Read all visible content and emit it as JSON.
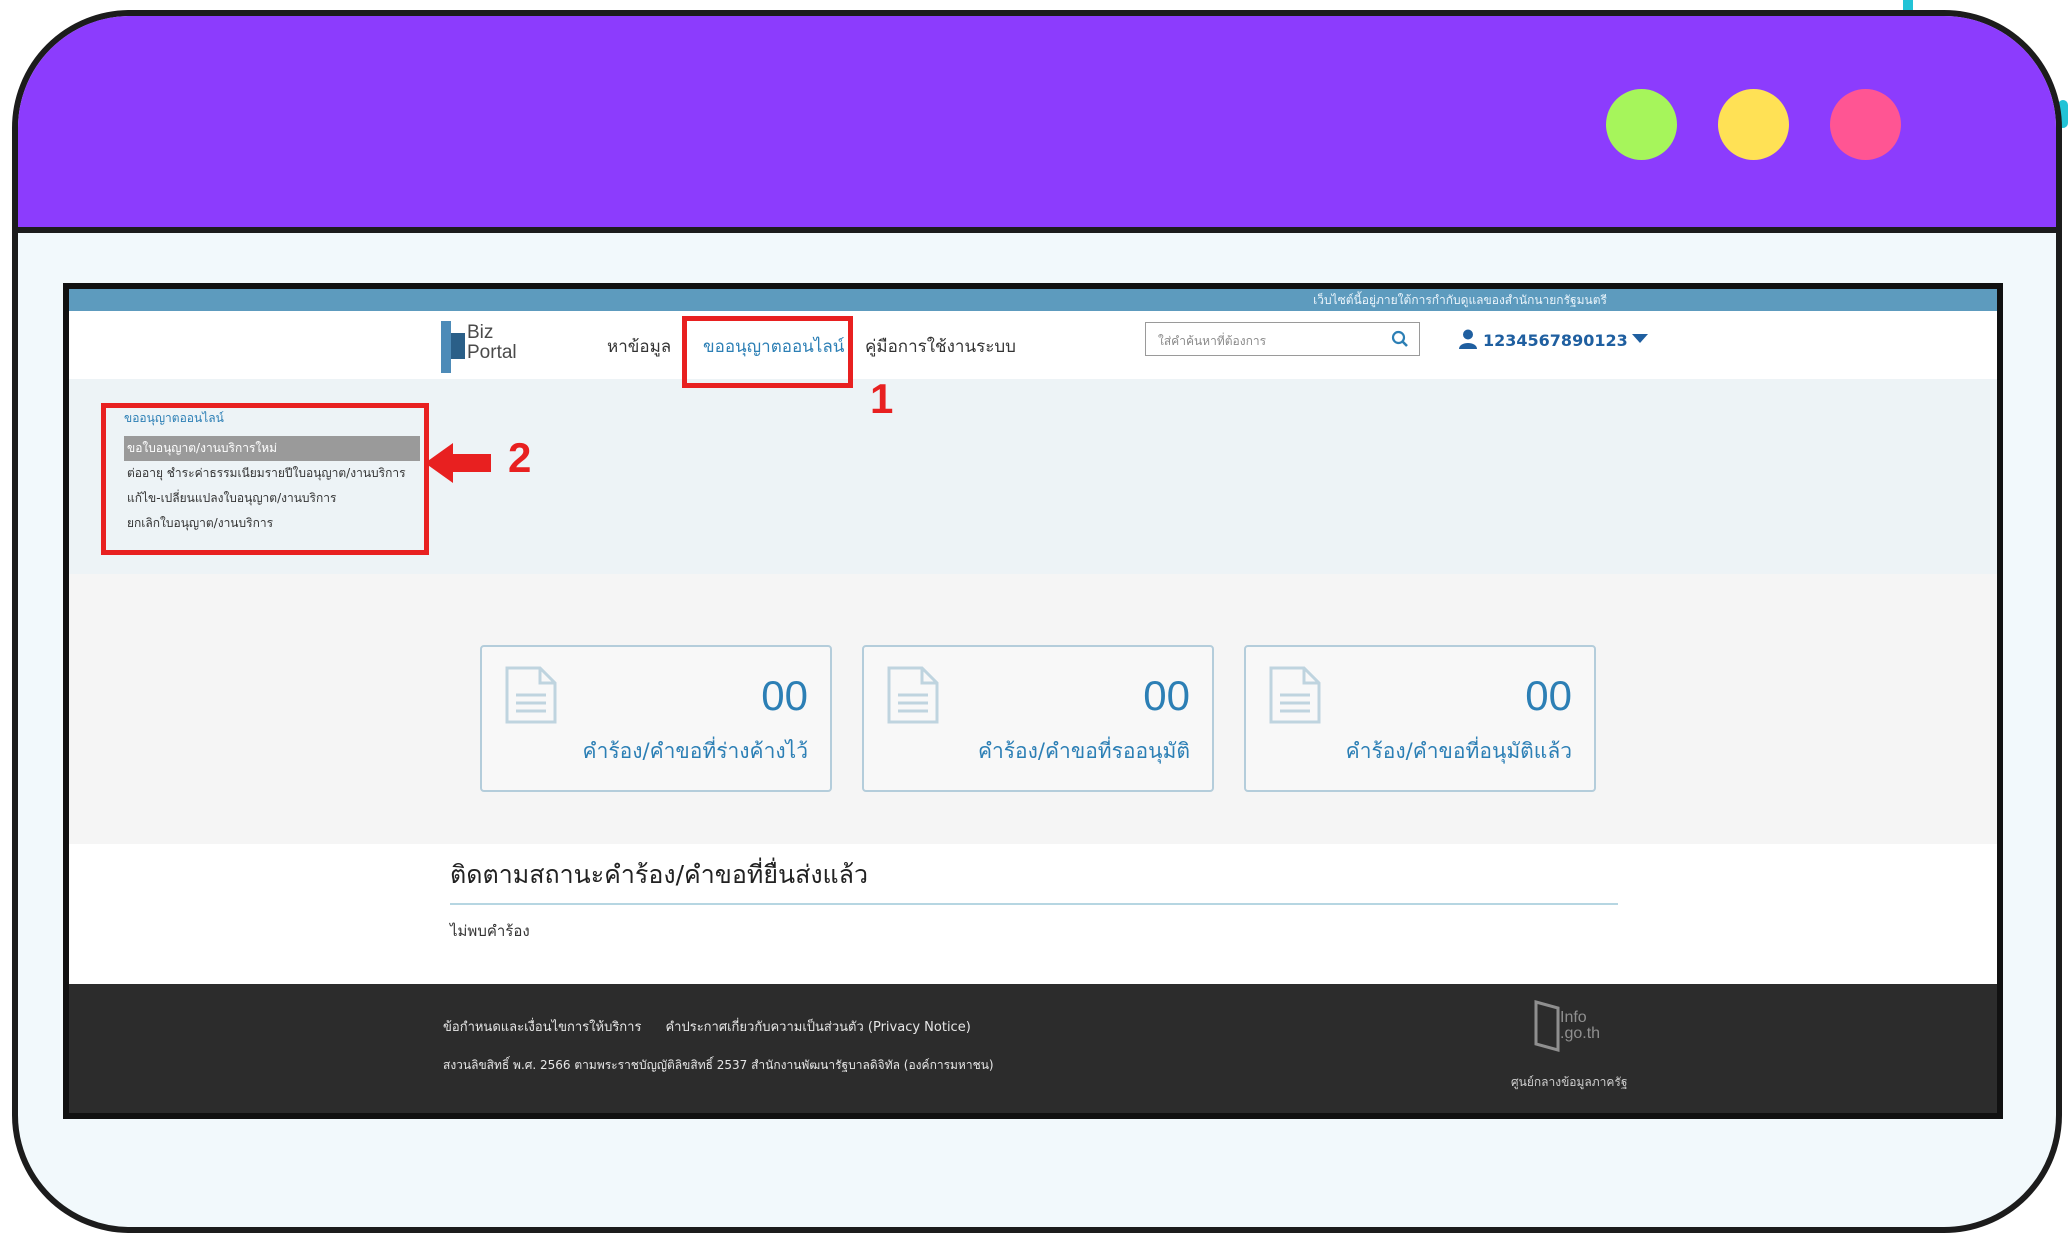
{
  "window": {
    "dots": [
      {
        "name": "green-dot",
        "color": "#a6f55b"
      },
      {
        "name": "yellow-dot",
        "color": "#ffe155"
      },
      {
        "name": "pink-dot",
        "color": "#ff5593"
      }
    ]
  },
  "site": {
    "top_notice": "เว็บไซต์นี้อยู่ภายใต้การกำกับดูแลของสำนักนายกรัฐมนตรี",
    "logo": {
      "line1": "Biz",
      "line2": "Portal"
    },
    "nav": [
      {
        "label": "หาข้อมูล",
        "active": false
      },
      {
        "label": "ขออนุญาตออนไลน์",
        "active": true
      },
      {
        "label": "คู่มือการใช้งานระบบ",
        "active": false
      }
    ],
    "search_placeholder": "ใส่คำค้นหาที่ต้องการ",
    "user_id": "1234567890123",
    "submenu": {
      "heading": "ขออนุญาตออนไลน์",
      "items": [
        {
          "label": "ขอใบอนุญาต/งานบริการใหม่",
          "selected": true
        },
        {
          "label": "ต่ออายุ ชำระค่าธรรมเนียมรายปีใบอนุญาต/งานบริการ",
          "selected": false
        },
        {
          "label": "แก้ไข-เปลี่ยนแปลงใบอนุญาต/งานบริการ",
          "selected": false
        },
        {
          "label": "ยกเลิกใบอนุญาต/งานบริการ",
          "selected": false
        }
      ]
    },
    "cards": [
      {
        "count": "00",
        "label": "คำร้อง/คำขอที่ร่างค้างไว้"
      },
      {
        "count": "00",
        "label": "คำร้อง/คำขอที่รออนุมัติ"
      },
      {
        "count": "00",
        "label": "คำร้อง/คำขอที่อนุมัติแล้ว"
      }
    ],
    "tracking": {
      "title": "ติดตามสถานะคำร้อง/คำขอที่ยื่นส่งแล้ว",
      "empty_text": "ไม่พบคำร้อง"
    },
    "footer": {
      "links": [
        "ข้อกำหนดและเงื่อนไขการให้บริการ",
        "คำประกาศเกี่ยวกับความเป็นส่วนตัว (Privacy Notice)"
      ],
      "copyright": "สงวนลิขสิทธิ์ พ.ศ. 2566 ตามพระราชบัญญัติลิขสิทธิ์ 2537 สำนักงานพัฒนารัฐบาลดิจิทัล (องค์การมหาชน)",
      "info_logo_line1": "Info",
      "info_logo_line2": ".go.th",
      "info_caption": "ศูนย์กลางข้อมูลภาครัฐ"
    }
  },
  "annotations": {
    "step1": "1",
    "step2": "2",
    "color": "#e82020"
  }
}
